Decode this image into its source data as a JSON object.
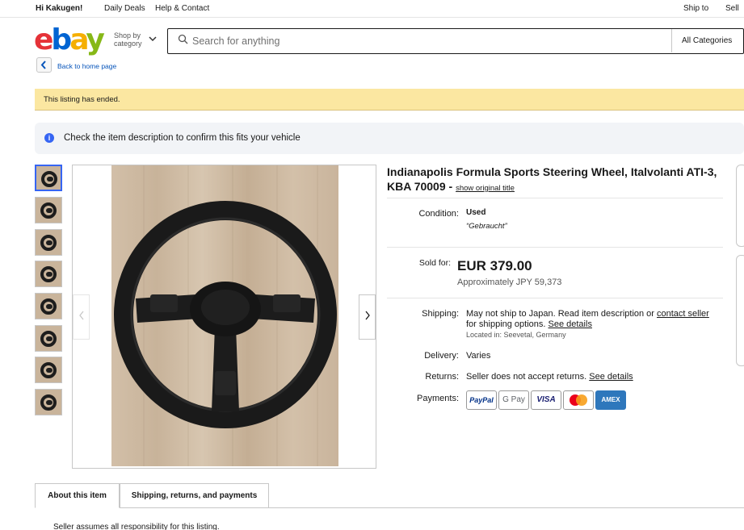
{
  "topnav": {
    "greeting": "Hi Kakugen!",
    "daily_deals": "Daily Deals",
    "help": "Help & Contact",
    "ship_to": "Ship to",
    "sell": "Sell"
  },
  "header": {
    "logo_letters": [
      "e",
      "b",
      "a",
      "y"
    ],
    "logo_colors": [
      "#e53238",
      "#0064d2",
      "#f5af02",
      "#86b817"
    ],
    "shop_by_line1": "Shop by",
    "shop_by_line2": "category",
    "search_placeholder": "Search for anything",
    "category_select": "All Categories",
    "back_label": "Back to home page"
  },
  "banners": {
    "ended": "This listing has ended.",
    "fit_notice": "Check the item description to confirm this fits your vehicle"
  },
  "gallery": {
    "thumbnail_count": 8,
    "selected_index": 0
  },
  "listing": {
    "title": "Indianapolis Formula Sports Steering Wheel, Italvolanti ATI-3, KBA 70009 - ",
    "show_original": "show original title",
    "condition_label": "Condition:",
    "condition_value": "Used",
    "condition_note": "“Gebraucht”",
    "sold_label": "Sold for:",
    "price": "EUR 379.00",
    "approx": "Approximately JPY 59,373",
    "shipping_label": "Shipping:",
    "shipping_text1": "May not ship to Japan. Read item description or ",
    "contact_seller": "contact seller",
    "shipping_text2": "for shipping options. ",
    "see_details": "See details",
    "located": "Located in: Seevetal, Germany",
    "delivery_label": "Delivery:",
    "delivery_value": "Varies",
    "returns_label": "Returns:",
    "returns_value": "Seller does not accept returns. ",
    "returns_details": "See details",
    "payments_label": "Payments:"
  },
  "payments": [
    {
      "name": "PayPal",
      "color": "#003087"
    },
    {
      "name": "G Pay",
      "color": "#5f6368"
    },
    {
      "name": "VISA",
      "color": "#1a1f71"
    },
    {
      "name": "",
      "color": "#eb001b"
    },
    {
      "name": "AMEX",
      "color": "#ffffff"
    }
  ],
  "tabs": {
    "about": "About this item",
    "shipping": "Shipping, returns, and payments"
  },
  "footer_note": "Seller assumes all responsibility for this listing."
}
